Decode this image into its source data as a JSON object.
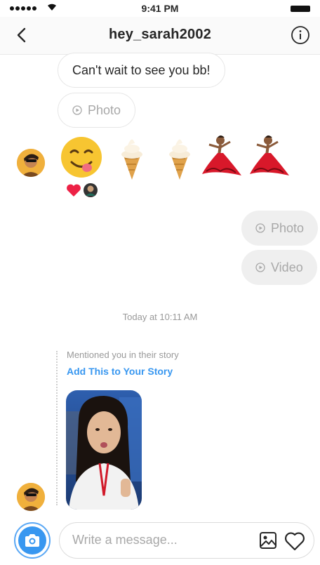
{
  "status_bar": {
    "time": "9:41 PM"
  },
  "header": {
    "title": "hey_sarah2002"
  },
  "messages": {
    "incoming_text": "Can't wait to see you bb!",
    "incoming_photo": "Photo",
    "outgoing_photo": "Photo",
    "outgoing_video": "Video"
  },
  "emojis": [
    "yum-face-emoji",
    "soft-ice-cream-emoji",
    "soft-ice-cream-emoji",
    "dancer-emoji",
    "dancer-emoji"
  ],
  "reactions": [
    "heart-reaction",
    "avatar-reaction"
  ],
  "timestamp": "Today at 10:11 AM",
  "story": {
    "mention_text": "Mentioned you in their story",
    "add_link": "Add This to Your Story"
  },
  "composer": {
    "placeholder": "Write a message..."
  },
  "colors": {
    "accent": "#3897f0",
    "bubble_out": "#efefef",
    "muted": "#a8a8a8"
  }
}
